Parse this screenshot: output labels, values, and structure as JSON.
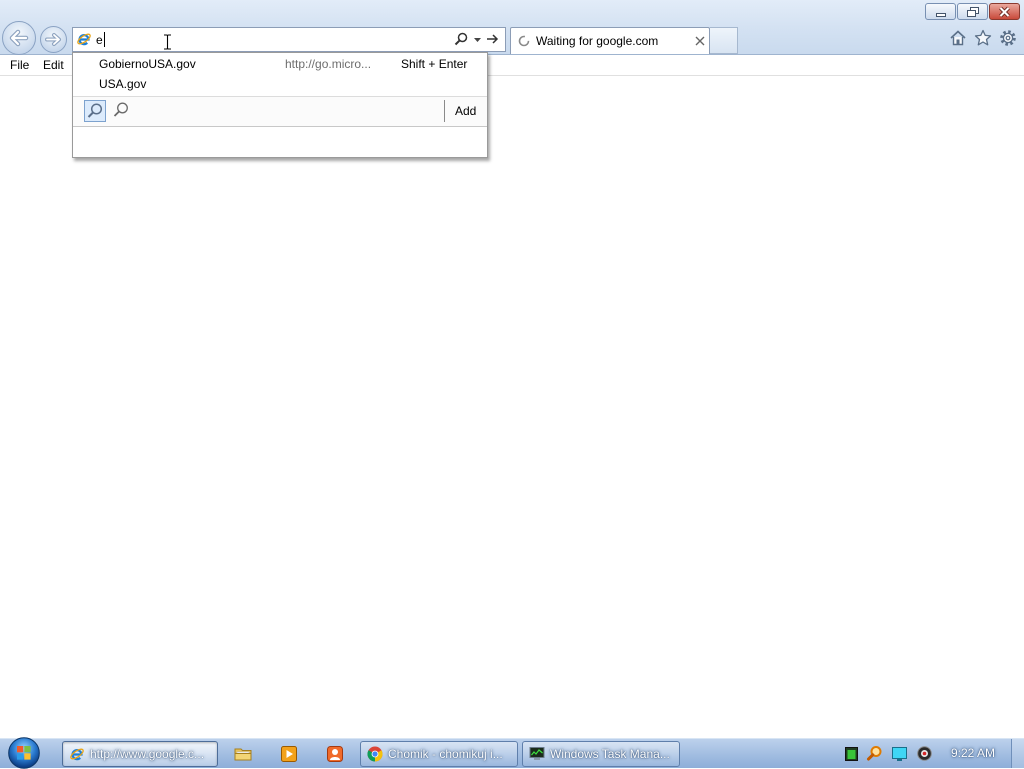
{
  "window": {
    "controls": [
      "minimize-icon",
      "restore-icon",
      "close-icon"
    ]
  },
  "toolbar": {
    "back_icon": "back-arrow-icon",
    "forward_icon": "forward-arrow-icon",
    "right_icons": [
      "home-icon",
      "favorites-star-icon",
      "tools-gear-icon"
    ]
  },
  "address_bar": {
    "value": "e",
    "site_icon": "ie-icon",
    "icons": [
      "search-icon",
      "dropdown-arrow-icon",
      "go-arrow-icon"
    ]
  },
  "tabs": [
    {
      "title": "Waiting for google.com",
      "icon": "loading-spinner-icon",
      "close_icon": "close-tab-icon"
    }
  ],
  "menu_bar": {
    "items": [
      "File",
      "Edit"
    ]
  },
  "autocomplete": {
    "suggestions": [
      {
        "label": "GobiernoUSA.gov",
        "url": "http://go.micro...",
        "shortcut": "Shift + Enter"
      },
      {
        "label": "USA.gov"
      }
    ],
    "search_providers": [
      "search-provider-icon",
      "search-provider-icon"
    ],
    "add_label": "Add"
  },
  "taskbar": {
    "start_icon": "windows-start-orb-icon",
    "buttons": [
      {
        "label": "http://www.google.c...",
        "icon": "ie-icon",
        "active": true
      },
      {
        "icon": "folder-icon"
      },
      {
        "icon": "media-player-icon"
      },
      {
        "icon": "app-icon"
      },
      {
        "label": "Chomik - chomikuj i...",
        "icon": "chrome-icon"
      },
      {
        "label": "Windows Task Mana...",
        "icon": "task-manager-icon"
      }
    ],
    "tray_icons": [
      "cpu-meter-icon",
      "search-tool-icon",
      "display-icon",
      "tray-app-icon"
    ],
    "clock": "9:22 AM"
  },
  "colors": {
    "frame": "#d3e1f2",
    "taskbar": "#9fbbe0",
    "close_button": "#c94a3b",
    "ie_blue": "#1d7fd6",
    "ie_ring": "#e8a417"
  }
}
